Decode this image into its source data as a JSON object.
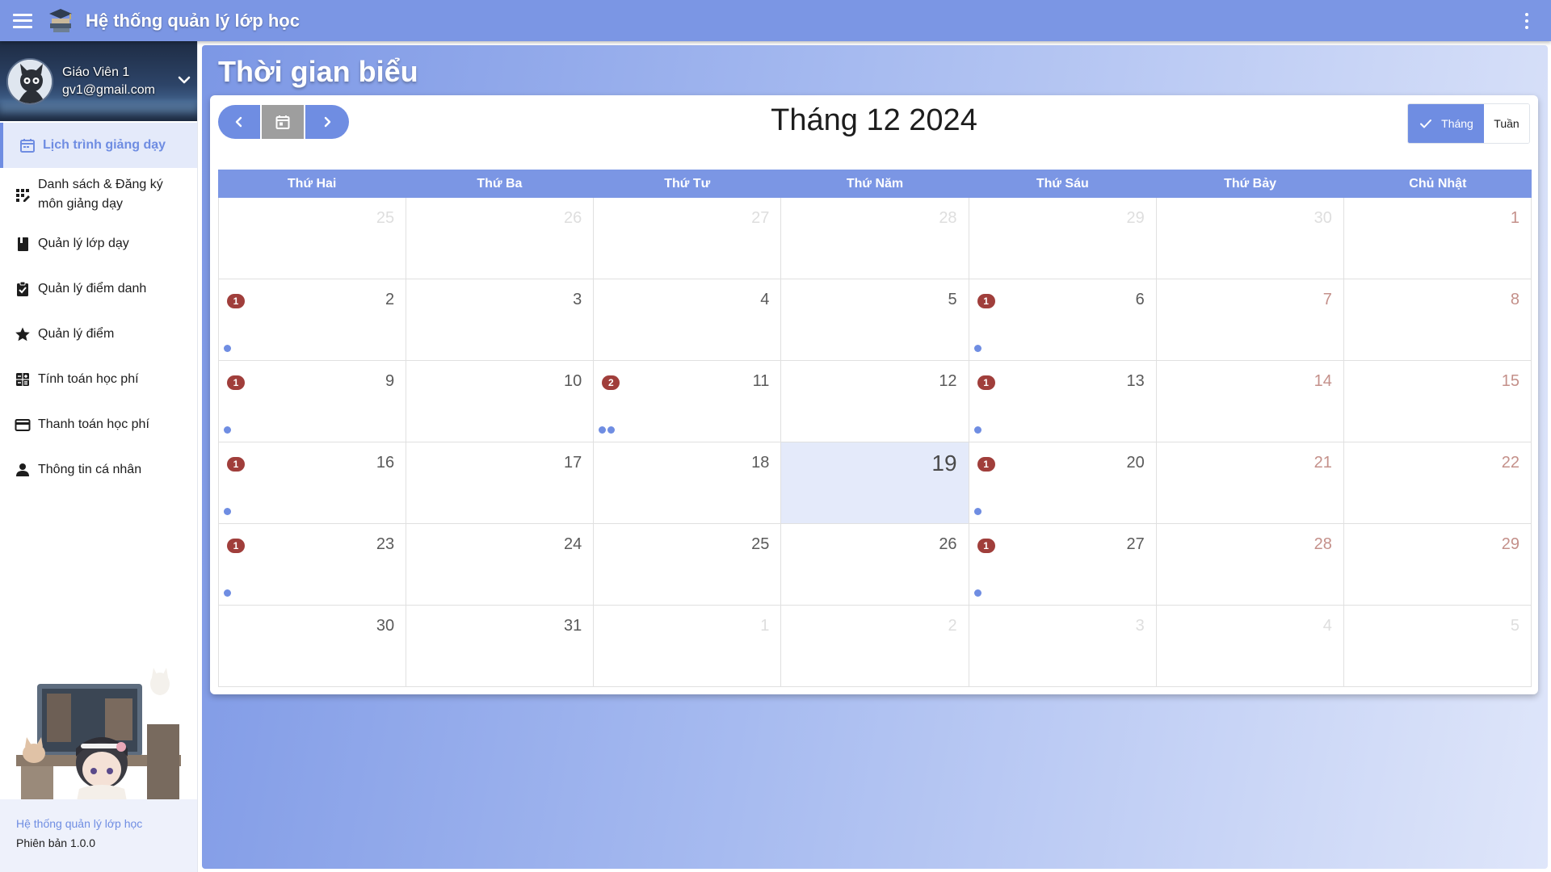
{
  "app": {
    "title": "Hệ thống quản lý lớp học"
  },
  "profile": {
    "name": "Giáo Viên 1",
    "email": "gv1@gmail.com"
  },
  "nav": [
    {
      "key": "schedule",
      "label": "Lịch trình giảng dạy",
      "icon": "calendar-icon",
      "active": true
    },
    {
      "key": "subjects",
      "label": "Danh sách & Đăng ký môn giảng dạy",
      "icon": "apps-icon",
      "active": false
    },
    {
      "key": "classes",
      "label": "Quản lý lớp dạy",
      "icon": "book-icon",
      "active": false
    },
    {
      "key": "attendance",
      "label": "Quản lý điểm danh",
      "icon": "clipboard-check-icon",
      "active": false
    },
    {
      "key": "grades",
      "label": "Quản lý điểm",
      "icon": "star-icon",
      "active": false
    },
    {
      "key": "tuition-calc",
      "label": "Tính toán học phí",
      "icon": "calculator-icon",
      "active": false
    },
    {
      "key": "tuition-pay",
      "label": "Thanh toán học phí",
      "icon": "credit-card-icon",
      "active": false
    },
    {
      "key": "profile",
      "label": "Thông tin cá nhân",
      "icon": "person-icon",
      "active": false
    }
  ],
  "footer": {
    "app_name": "Hệ thống quản lý lớp học",
    "version": "Phiên bản 1.0.0"
  },
  "page": {
    "title": "Thời gian biểu"
  },
  "calendar": {
    "title": "Tháng 12 2024",
    "views": {
      "month": "Tháng",
      "week": "Tuần",
      "selected": "month"
    },
    "weekdays": [
      "Thứ Hai",
      "Thứ Ba",
      "Thứ Tư",
      "Thứ Năm",
      "Thứ Sáu",
      "Thứ Bảy",
      "Chủ Nhật"
    ],
    "weeks": [
      [
        {
          "day": 25,
          "outside": true
        },
        {
          "day": 26,
          "outside": true
        },
        {
          "day": 27,
          "outside": true
        },
        {
          "day": 28,
          "outside": true
        },
        {
          "day": 29,
          "outside": true
        },
        {
          "day": 30,
          "outside": true
        },
        {
          "day": 1
        }
      ],
      [
        {
          "day": 2,
          "badge": 1,
          "dots": 1
        },
        {
          "day": 3
        },
        {
          "day": 4
        },
        {
          "day": 5
        },
        {
          "day": 6,
          "badge": 1,
          "dots": 1
        },
        {
          "day": 7
        },
        {
          "day": 8
        }
      ],
      [
        {
          "day": 9,
          "badge": 1,
          "dots": 1
        },
        {
          "day": 10
        },
        {
          "day": 11,
          "badge": 2,
          "dots": 2
        },
        {
          "day": 12
        },
        {
          "day": 13,
          "badge": 1,
          "dots": 1
        },
        {
          "day": 14
        },
        {
          "day": 15
        }
      ],
      [
        {
          "day": 16,
          "badge": 1,
          "dots": 1
        },
        {
          "day": 17
        },
        {
          "day": 18
        },
        {
          "day": 19,
          "today": true
        },
        {
          "day": 20,
          "badge": 1,
          "dots": 1
        },
        {
          "day": 21
        },
        {
          "day": 22
        }
      ],
      [
        {
          "day": 23,
          "badge": 1,
          "dots": 1
        },
        {
          "day": 24
        },
        {
          "day": 25
        },
        {
          "day": 26
        },
        {
          "day": 27,
          "badge": 1,
          "dots": 1
        },
        {
          "day": 28
        },
        {
          "day": 29
        }
      ],
      [
        {
          "day": 30
        },
        {
          "day": 31
        },
        {
          "day": 1,
          "outside": true
        },
        {
          "day": 2,
          "outside": true
        },
        {
          "day": 3,
          "outside": true
        },
        {
          "day": 4,
          "outside": true
        },
        {
          "day": 5,
          "outside": true
        }
      ]
    ]
  },
  "colors": {
    "primary": "#7b96e4",
    "accent": "#6f8de2",
    "badge": "#a03e3b",
    "today_bg": "#e4eafa",
    "weekend_text": "#c4908a"
  }
}
